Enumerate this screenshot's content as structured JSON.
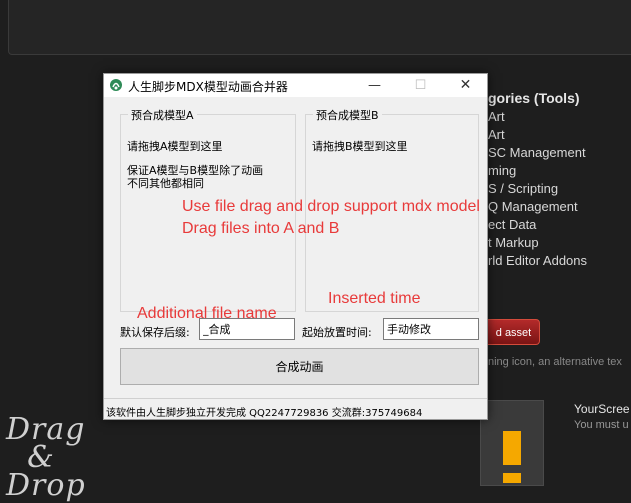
{
  "background": {
    "heading": "gories (Tools)",
    "menu_items": [
      "Art",
      "Art",
      "SC Management",
      "ming",
      "S / Scripting",
      "Q Management",
      "ect Data",
      "t Markup",
      "rld Editor Addons"
    ],
    "asset_button": "d asset",
    "hint_text": "ning icon, an alternative tex",
    "screenshot_title": "YourScree",
    "screenshot_subtitle": "You must u",
    "logo_text": "Drag\n  &\nDrop"
  },
  "window": {
    "title": "人生脚步MDX模型动画合并器",
    "controls": {
      "minimize": "—",
      "maximize": "☐",
      "close": "✕"
    }
  },
  "group_a": {
    "title": "预合成模型A",
    "line1": "请拖拽A模型到这里",
    "line2": "保证A模型与B模型除了动画",
    "line3": "不同其他都相同"
  },
  "group_b": {
    "title": "预合成模型B",
    "line1": "请拖拽B模型到这里"
  },
  "annotations": {
    "drag_drop_1": "Use file drag and drop support mdx model",
    "drag_drop_2": "Drag files into A and B",
    "file_name": "Additional file name",
    "inserted_time": "Inserted time",
    "color": "#e83a3a"
  },
  "fields": {
    "suffix_label": "默认保存后缀:",
    "suffix_value": "_合成",
    "start_time_label": "起始放置时间:",
    "start_time_value": "手动修改"
  },
  "merge_button": "合成动画",
  "status": "该软件由人生脚步独立开发完成 QQ2247729836 交流群:375749684"
}
